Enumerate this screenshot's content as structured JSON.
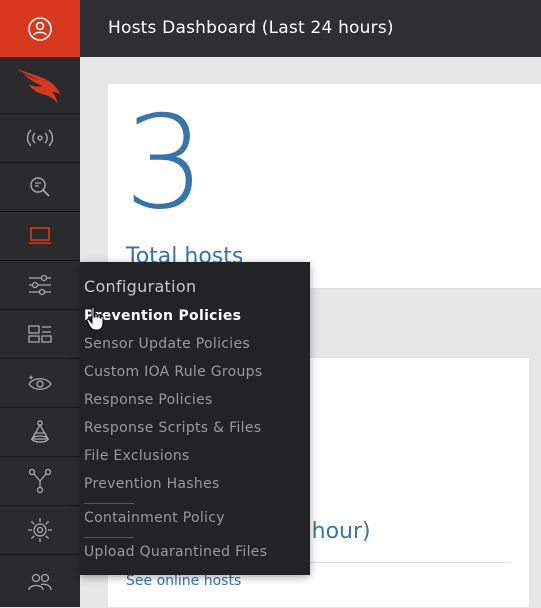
{
  "header": {
    "title": "Hosts Dashboard (Last 24 hours)"
  },
  "colors": {
    "accent": "#d8391e",
    "link": "#3a73a8",
    "rail": "#2b2b2d"
  },
  "rail": {
    "items": [
      {
        "name": "user-icon"
      },
      {
        "name": "falcon-logo-icon"
      },
      {
        "name": "activity-icon"
      },
      {
        "name": "investigate-icon"
      },
      {
        "name": "hosts-icon"
      },
      {
        "name": "configuration-icon"
      },
      {
        "name": "dashboards-icon"
      },
      {
        "name": "discover-icon"
      },
      {
        "name": "spotlight-icon"
      },
      {
        "name": "network-icon"
      },
      {
        "name": "intelligence-icon"
      },
      {
        "name": "users-icon"
      }
    ]
  },
  "card1": {
    "count": "3",
    "label": "Total hosts"
  },
  "card2": {
    "heading": "t hour)",
    "link": "See online hosts"
  },
  "flyout": {
    "title": "Configuration",
    "items": [
      "Prevention Policies",
      "Sensor Update Policies",
      "Custom IOA Rule Groups",
      "Response Policies",
      "Response Scripts & Files",
      "File Exclusions",
      "Prevention Hashes",
      "Containment Policy",
      "Upload Quarantined Files"
    ]
  }
}
